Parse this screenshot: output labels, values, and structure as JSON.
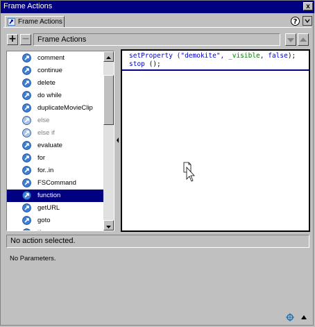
{
  "window": {
    "title": "Frame Actions",
    "close_glyph": "x"
  },
  "tab": {
    "label": "Frame Actions",
    "help_glyph": "?"
  },
  "toolbar": {
    "add_glyph": "+",
    "remove_glyph": "−",
    "title": "Frame Actions"
  },
  "actions": {
    "items": [
      {
        "label": "comment",
        "disabled": false,
        "selected": false
      },
      {
        "label": "continue",
        "disabled": false,
        "selected": false
      },
      {
        "label": "delete",
        "disabled": false,
        "selected": false
      },
      {
        "label": "do while",
        "disabled": false,
        "selected": false
      },
      {
        "label": "duplicateMovieClip",
        "disabled": false,
        "selected": false
      },
      {
        "label": "else",
        "disabled": true,
        "selected": false
      },
      {
        "label": "else if",
        "disabled": true,
        "selected": false
      },
      {
        "label": "evaluate",
        "disabled": false,
        "selected": false
      },
      {
        "label": "for",
        "disabled": false,
        "selected": false
      },
      {
        "label": "for..in",
        "disabled": false,
        "selected": false
      },
      {
        "label": "FSCommand",
        "disabled": false,
        "selected": false
      },
      {
        "label": "function",
        "disabled": false,
        "selected": true
      },
      {
        "label": "getURL",
        "disabled": false,
        "selected": false
      },
      {
        "label": "goto",
        "disabled": false,
        "selected": false
      },
      {
        "label": "if",
        "disabled": false,
        "selected": false
      }
    ]
  },
  "script": {
    "lines": [
      {
        "prefix": "setProperty (\"demokite\", ",
        "prop": "_visible",
        "middle": ", ",
        "keyword": "false",
        "suffix": ");"
      },
      {
        "stmt": "stop",
        "suffix": " ();"
      }
    ]
  },
  "status": {
    "text": "No action selected."
  },
  "params": {
    "text": "No Parameters."
  },
  "colors": {
    "titlebar": "#000080",
    "selection": "#000080",
    "keyword": "#0000cc",
    "property": "#008000",
    "action_icon": "#3c7fd4"
  },
  "icons": {
    "action_item": "action-circle-arrow-icon",
    "target": "crosshair-target-icon",
    "collapse": "triangle-up-icon",
    "tab": "flash-tab-icon",
    "cursor": "document-pointer-cursor-icon"
  }
}
